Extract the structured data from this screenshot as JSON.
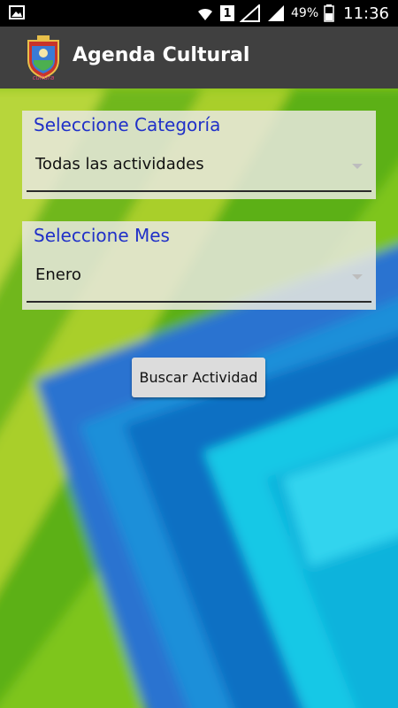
{
  "status_bar": {
    "sim_slot": "1",
    "battery": "49%",
    "time": "11:36",
    "icons": [
      "image-icon",
      "wifi-icon",
      "signal-icon",
      "battery-icon"
    ]
  },
  "app_bar": {
    "title": "Agenda Cultural",
    "logo": "coat-of-arms-logo"
  },
  "category": {
    "label": "Seleccione Categoría",
    "value": "Todas las actividades"
  },
  "month": {
    "label": "Seleccione Mes",
    "value": "Enero"
  },
  "search_button": {
    "label": "Buscar Actividad"
  },
  "colors": {
    "label_blue": "#2030c8",
    "app_bar": "#404040",
    "green": "#7ec51a",
    "blue": "#1a8fd9",
    "cyan": "#14c8e6"
  }
}
